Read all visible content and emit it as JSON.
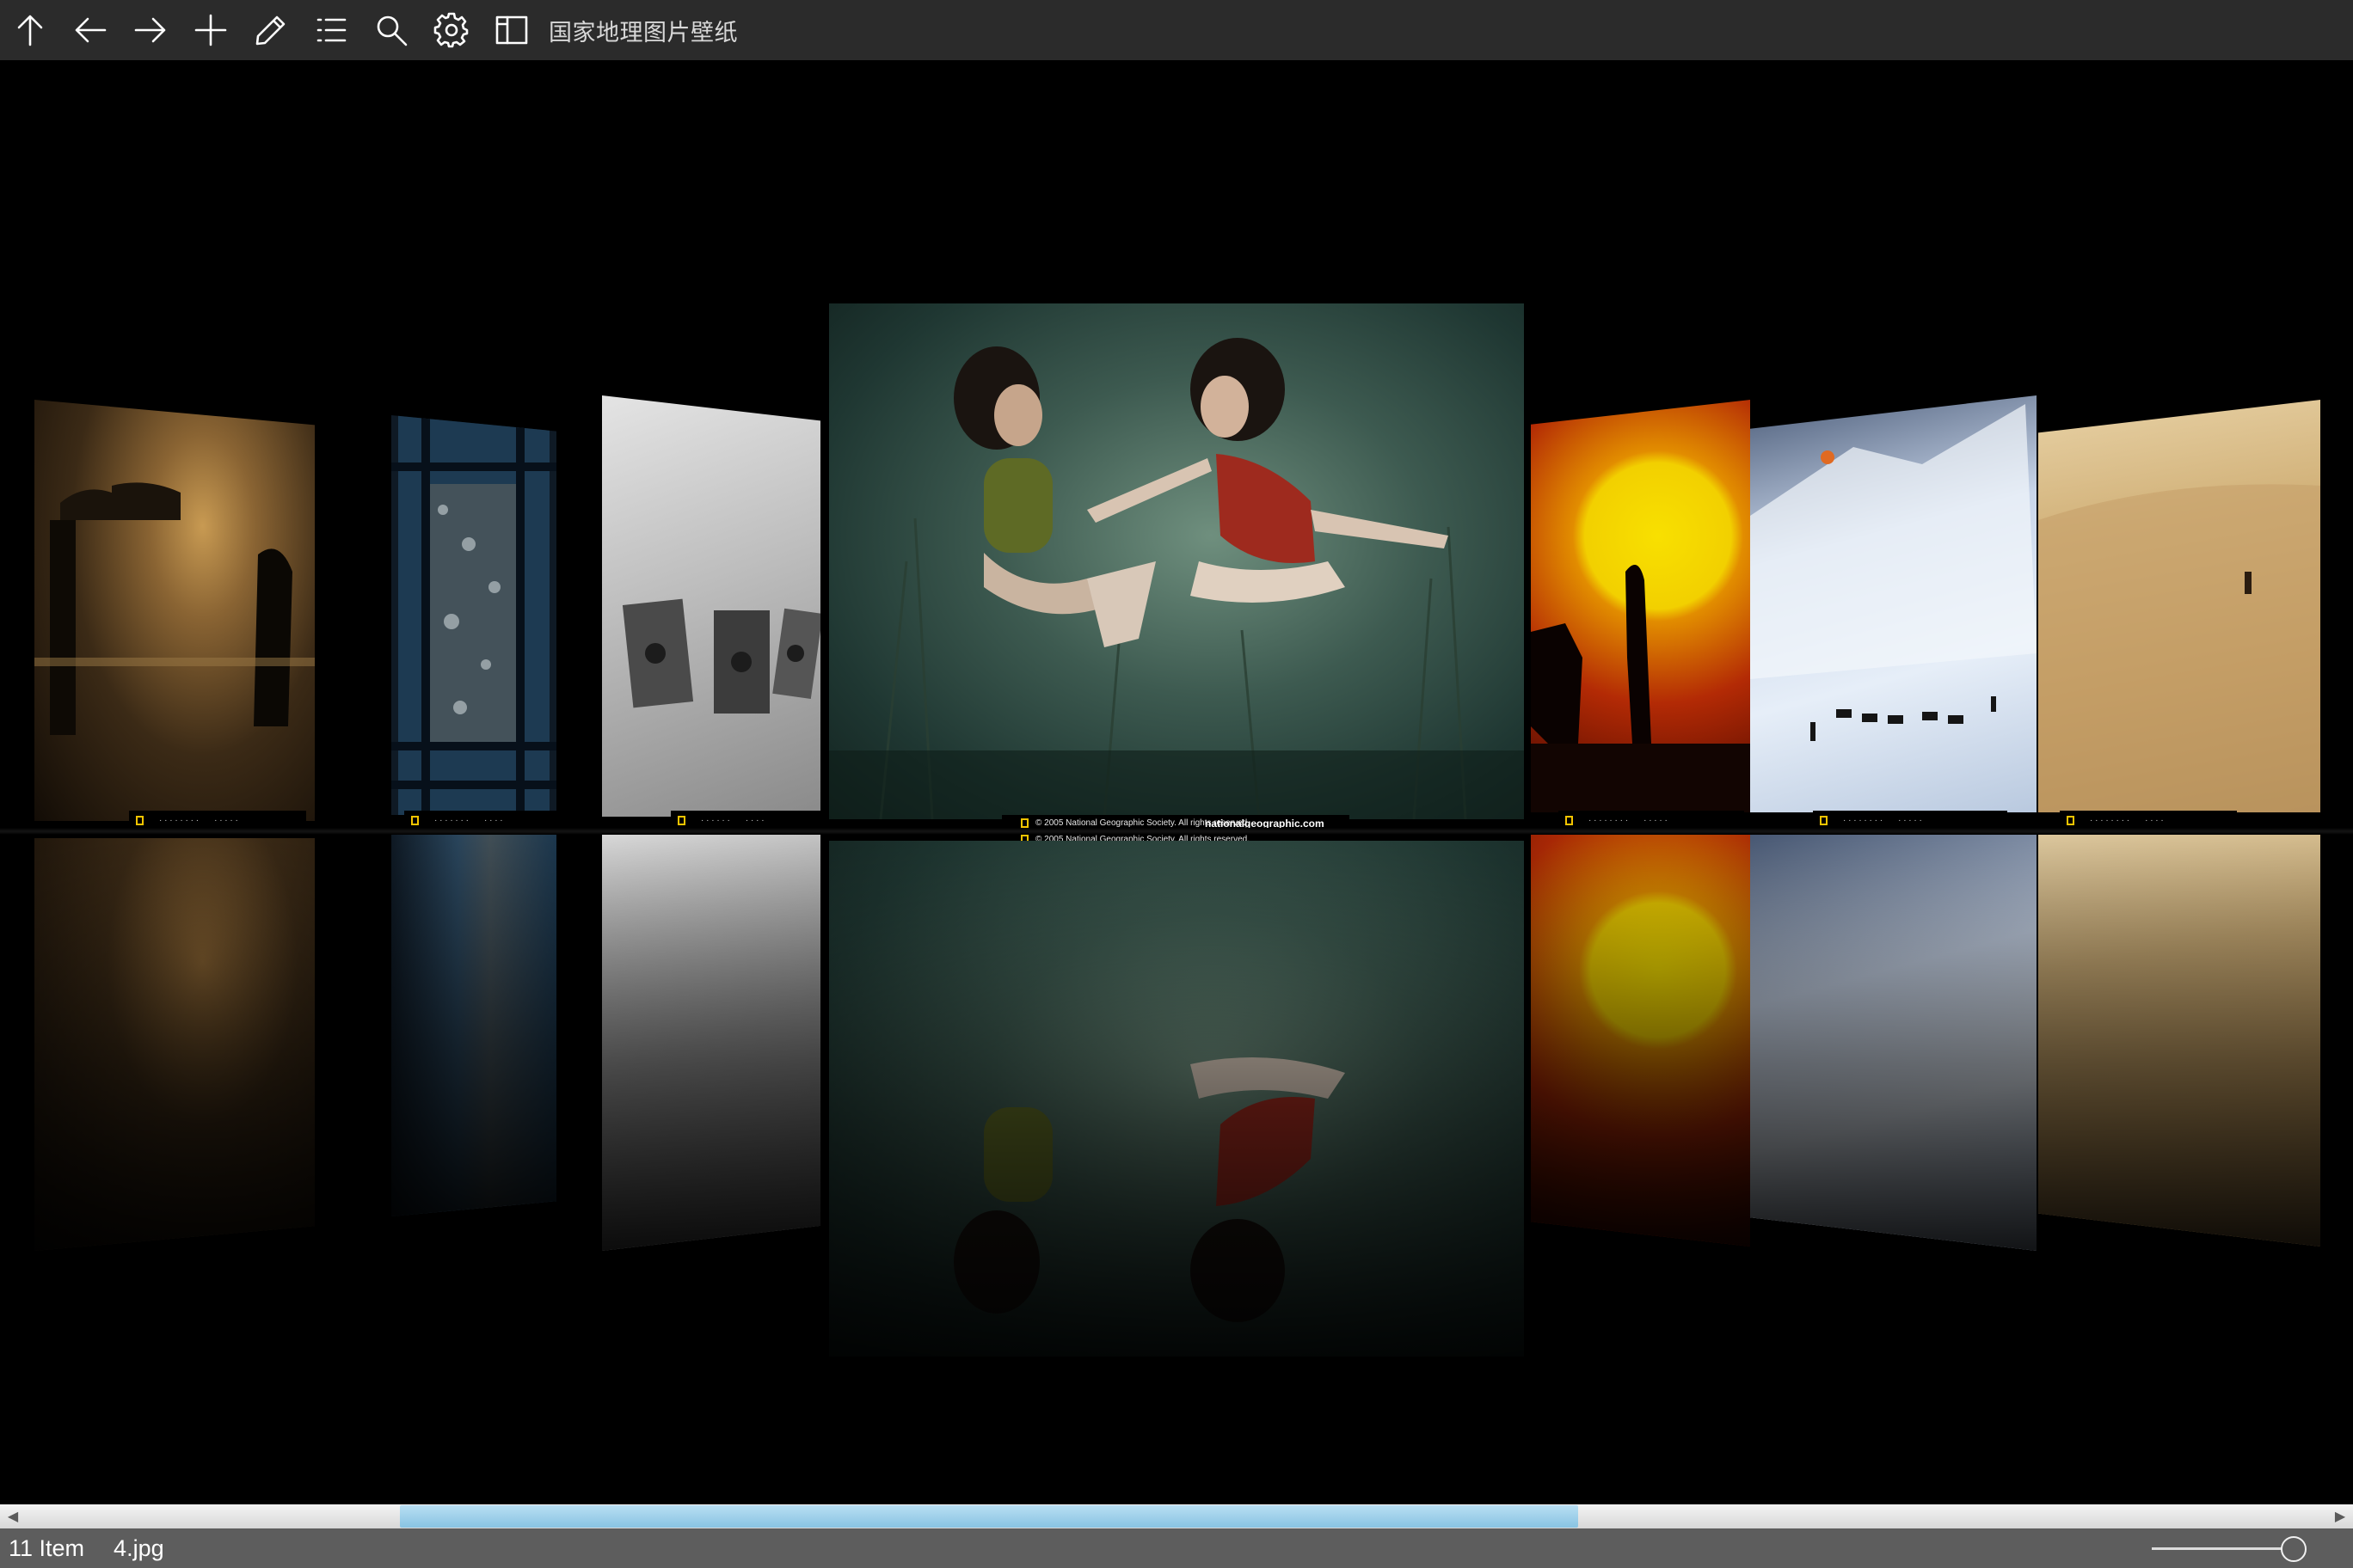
{
  "window": {
    "title": "国家地理图片壁纸"
  },
  "toolbar": {
    "buttons": [
      {
        "name": "up",
        "icon": "arrow-up-icon"
      },
      {
        "name": "back",
        "icon": "arrow-left-icon"
      },
      {
        "name": "forward",
        "icon": "arrow-right-icon"
      },
      {
        "name": "add",
        "icon": "plus-icon"
      },
      {
        "name": "edit",
        "icon": "pencil-icon"
      },
      {
        "name": "list",
        "icon": "list-icon"
      },
      {
        "name": "search",
        "icon": "search-icon"
      },
      {
        "name": "settings",
        "icon": "gear-icon"
      },
      {
        "name": "layout",
        "icon": "layout-panel-icon"
      }
    ]
  },
  "gallery": {
    "tiles": [
      {
        "subject": "sunset beach silhouettes"
      },
      {
        "subject": "framed lichen window"
      },
      {
        "subject": "wooden stocks black and white"
      },
      {
        "subject": "underwater swimmers",
        "selected": true
      },
      {
        "subject": "red sun silhouette rider"
      },
      {
        "subject": "snow mountain caravan"
      },
      {
        "subject": "desert dune walker"
      }
    ],
    "main_caption": {
      "line1": "© 2005 National Geographic Society. All rights reserved.",
      "line2": "© 2005 National Geographic Society. All rights reserved.",
      "url": "nationalgeographic.com"
    }
  },
  "status": {
    "item_count": "11 Item",
    "file_name": "4.jpg"
  },
  "colors": {
    "toolbar": "#2b2b2b",
    "status": "#5d5d5d",
    "scroll_thumb": "#9fd0ea"
  }
}
